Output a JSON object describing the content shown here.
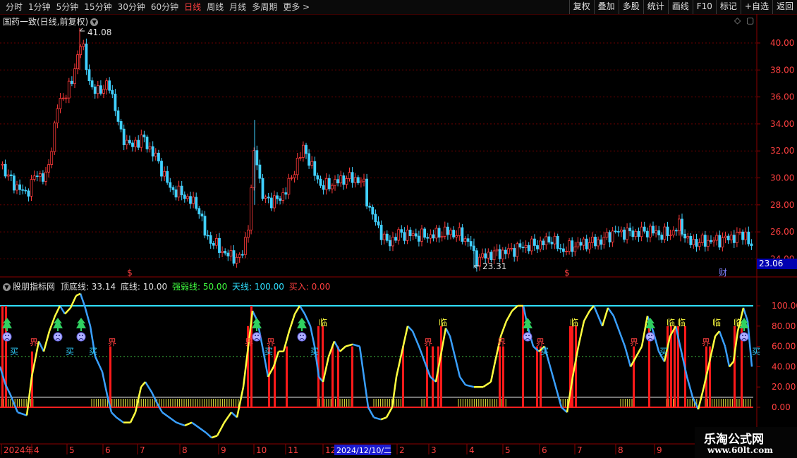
{
  "toolbar": {
    "periods": [
      "分时",
      "1分钟",
      "5分钟",
      "15分钟",
      "30分钟",
      "60分钟",
      "日线",
      "周线",
      "月线",
      "多周期",
      "更多 >"
    ],
    "active_period": "日线",
    "buttons": [
      "复权",
      "叠加",
      "多股",
      "统计",
      "画线",
      "F10",
      "标记",
      "+自选",
      "返回"
    ]
  },
  "chart": {
    "title": "国药一致(日线,前复权)",
    "high_label": "41.08",
    "low_label": "23.31",
    "price_tag": "23.06",
    "price_axis": [
      "40.00",
      "38.00",
      "36.00",
      "34.00",
      "32.00",
      "30.00",
      "28.00",
      "26.00",
      "24.00"
    ],
    "markers": [
      "$",
      "$",
      "财"
    ]
  },
  "indicator": {
    "name": "股朋指标网",
    "top_label": "顶底线:",
    "top_value": "33.14",
    "bottom_label": "底线:",
    "bottom_value": "10.00",
    "strong_label": "强弱线:",
    "strong_value": "50.00",
    "sky_label": "天线:",
    "sky_value": "100.00",
    "buy_label": "买入:",
    "buy_value": "0.00",
    "axis": [
      "100.00",
      "80.00",
      "60.00",
      "40.00",
      "20.00",
      "0.00"
    ],
    "signal_jie": "界",
    "signal_lin": "临",
    "signal_mai": "买"
  },
  "time_axis": {
    "labels": [
      "2024年",
      "4",
      "5",
      "6",
      "7",
      "8",
      "9",
      "10",
      "11",
      "12",
      "2",
      "3",
      "4",
      "5",
      "6",
      "7",
      "8",
      "9"
    ],
    "cursor_date": "2024/12/10/二"
  },
  "watermark": {
    "line1": "乐淘公式网",
    "line2": "www.60lt.com"
  },
  "colors": {
    "up": "#ff3a3a",
    "down": "#40d0ff",
    "sky": "#30e0ff",
    "yellow": "#ffff40",
    "blue": "#3aa0ff",
    "red_line": "#ff2020"
  }
}
